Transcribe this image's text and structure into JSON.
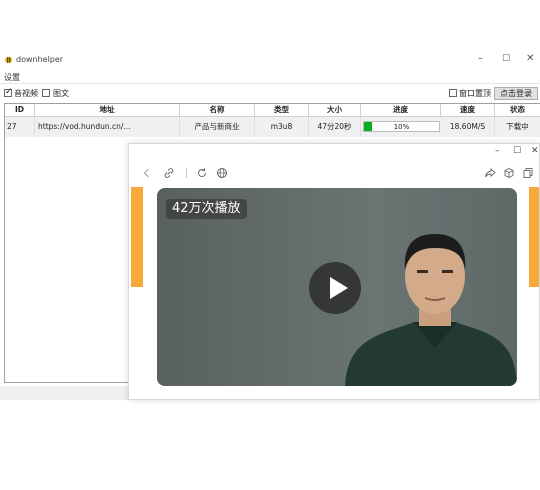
{
  "window": {
    "title": "downhelper"
  },
  "menu": {
    "settings": "设置"
  },
  "toolbar": {
    "audio_video": {
      "label": "音视频",
      "checked": true
    },
    "image_text": {
      "label": "图文",
      "checked": false
    },
    "window_on_top": {
      "label": "窗口置顶",
      "checked": false
    },
    "login_button": "点击登录"
  },
  "table": {
    "headers": [
      "ID",
      "地址",
      "名称",
      "类型",
      "大小",
      "进度",
      "速度",
      "状态"
    ],
    "rows": [
      {
        "id": "27",
        "url": "https://vod.hundun.cn/...",
        "name": "产品与新商业",
        "type": "m3u8",
        "size": "47分20秒",
        "progress_text": "10%",
        "progress_value": 0.1,
        "speed": "18.60M/S",
        "status": "下载中"
      }
    ]
  },
  "popup": {
    "views_badge": "42万次播放",
    "accent_color": "#f7a93a"
  },
  "colors": {
    "progress_fill": "#06b025"
  }
}
